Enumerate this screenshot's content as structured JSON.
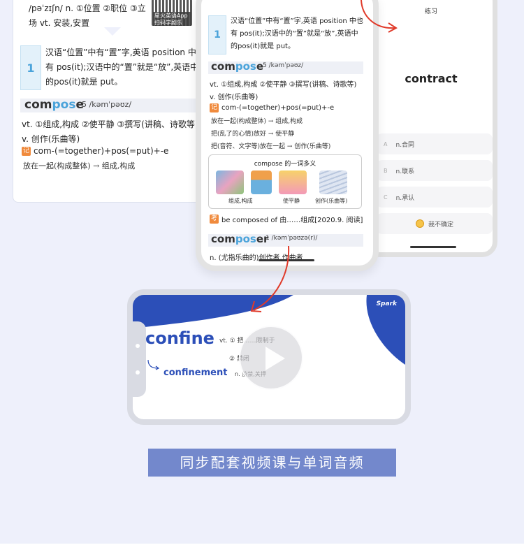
{
  "book_page": {
    "top_line1": "/pəˈzɪʃn/ n. ①位置 ②职位 ③立",
    "top_line2": "场   vt. 安装,安置",
    "qr_label": "星火英语App 扫码学剧乐",
    "note_num": "1",
    "note_text": "汉语“位置”中有“置”字,英语 position 中也有 pos(it);汉语中的“置”就是“放”,英语中的pos(it)就是 put。",
    "word_prefix": "com",
    "word_root": "pos",
    "word_suffix": "e",
    "phonetic": "5 /kəmˈpəʊz/",
    "def1": "vt. ①组成,构成 ②使平静 ③撰写(讲稿、诗歌等)",
    "def2": "v. 创作(乐曲等)",
    "mem_icon": "记",
    "mem_text": "com-(=together)+pos(=put)+-e",
    "handwrite": "放在一起(构成整体) → 组成,构成"
  },
  "center_phone": {
    "note_num": "1",
    "note_text": "汉语“位置”中有“置”字,英语 position 中也有 pos(it);汉语中的“置”就是“放”,英语中的pos(it)就是 put。",
    "word_prefix": "com",
    "word_root": "pos",
    "word_suffix": "e",
    "phonetic": "5 /kəmˈpəʊz/",
    "def1": "vt. ①组成,构成 ②使平静 ③撰写(讲稿、诗歌等)",
    "def2": "v. 创作(乐曲等)",
    "mem_text": "com-(=together)+pos(=put)+-e",
    "hand1": "放在一起(构成整体) → 组成,构成",
    "hand2": "把(乱了的心情)放好 → 使平静",
    "hand3": "把(音符、文字等)放在一起 → 创作(乐曲等)",
    "box_title": "compose 的一词多义",
    "captions": [
      "组成,构成",
      "使平静",
      "创作(乐曲等)"
    ],
    "exam_icon": "考",
    "exam_text": "be composed of 由……组成[2020.9. 阅读]",
    "word2_prefix": "com",
    "word2_root": "pos",
    "word2_suffix": "er",
    "phonetic2": "1 /kəmˈpəʊzə(r)/",
    "def3": "n. (尤指乐曲的)创作者,作曲者"
  },
  "quiz_phone": {
    "title": "练习",
    "word": "contract",
    "options": [
      {
        "letter": "A",
        "text": "n.合同"
      },
      {
        "letter": "B",
        "text": "n.联系"
      },
      {
        "letter": "C",
        "text": "n.承认"
      }
    ],
    "unsure": "我不确定"
  },
  "video": {
    "brand": "Spark",
    "word": "confine",
    "def1": "vt. ① 把……限制于",
    "def2": "② 禁闭",
    "word2": "confinement",
    "def3": "n. 监禁,关押"
  },
  "caption": "同步配套视频课与单词音频",
  "colors": {
    "accent_blue": "#2c4fb8",
    "caption_bg": "#7388cc",
    "root_blue": "#4aa3da",
    "arrow_red": "#e03a2a"
  }
}
